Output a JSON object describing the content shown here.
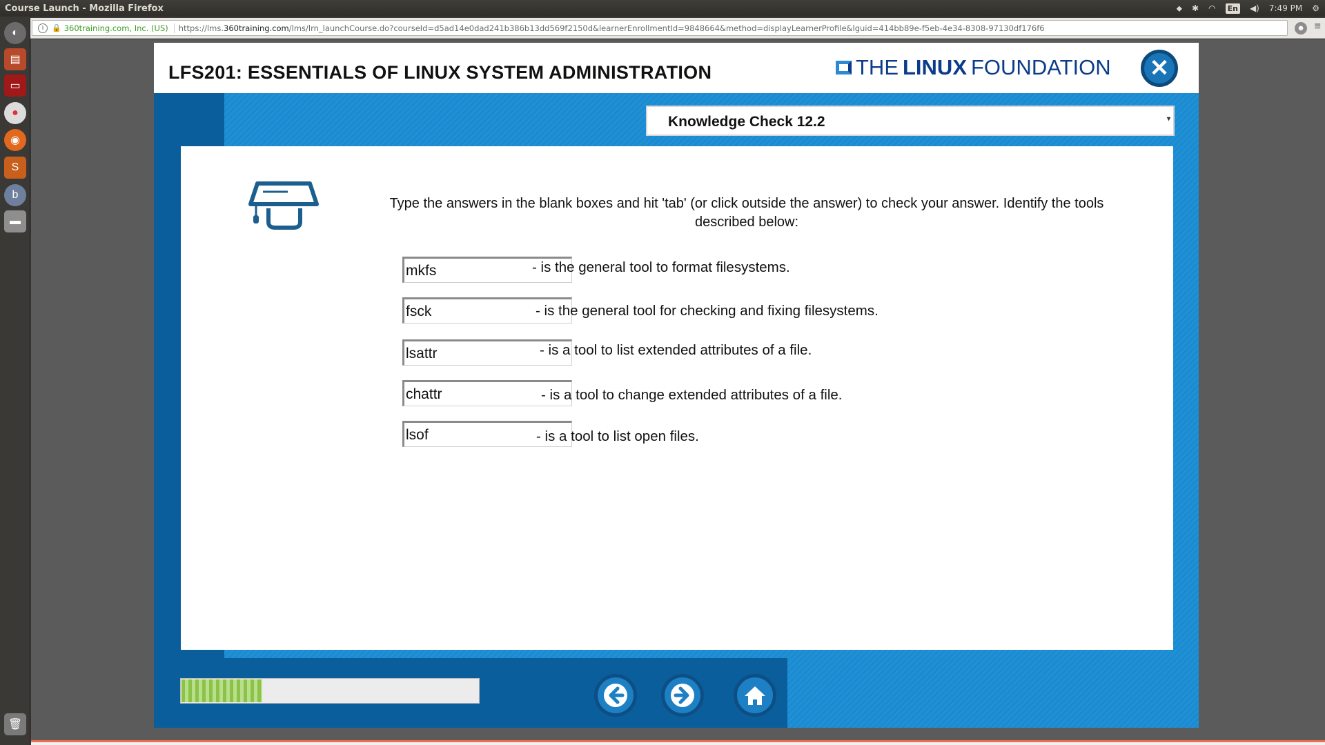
{
  "window": {
    "title": "Course Launch - Mozilla Firefox"
  },
  "tray": {
    "keyboard": "En",
    "time": "7:49 PM"
  },
  "browser": {
    "site_identity": "360training.com, Inc. (US)",
    "url_prefix": "https://lms.",
    "url_domain": "360training.com",
    "url_path": "/lms/lrn_launchCourse.do?courseId=d5ad14e0dad241b386b13dd569f2150d&learnerEnrollmentId=9848664&method=displayLearnerProfile&lguid=414bb89e-f5eb-4e34-8308-97130df176f6"
  },
  "course": {
    "title": "LFS201: ESSENTIALS OF LINUX SYSTEM ADMINISTRATION",
    "brand_pre": "THE",
    "brand_bold": "LINUX",
    "brand_post": "FOUNDATION",
    "close_label": "✕"
  },
  "knowledge_check": {
    "selected": "Knowledge Check 12.2",
    "instructions": "Type the answers in the blank boxes and hit 'tab' (or click outside the answer) to check your answer. Identify the tools described below:",
    "items": [
      {
        "answer": "mkfs",
        "description": "- is the general tool to format filesystems."
      },
      {
        "answer": "fsck",
        "description": "- is the general tool for checking and fixing filesystems."
      },
      {
        "answer": "lsattr",
        "description": "- is a tool to list extended attributes of a file."
      },
      {
        "answer": "chattr",
        "description": "- is a tool to change extended attributes of a file."
      },
      {
        "answer": "lsof",
        "description": "- is a tool to list open files."
      }
    ]
  },
  "progress": {
    "fraction": 0.27
  },
  "colors": {
    "brand_blue": "#0b3b8a",
    "panel_blue": "#1a86c8",
    "dark_blue": "#0b5e9c",
    "progress_green": "#8bc34a"
  },
  "icons": [
    "back-arrow-icon",
    "forward-arrow-icon",
    "home-icon",
    "graduation-cap-icon",
    "close-icon"
  ]
}
